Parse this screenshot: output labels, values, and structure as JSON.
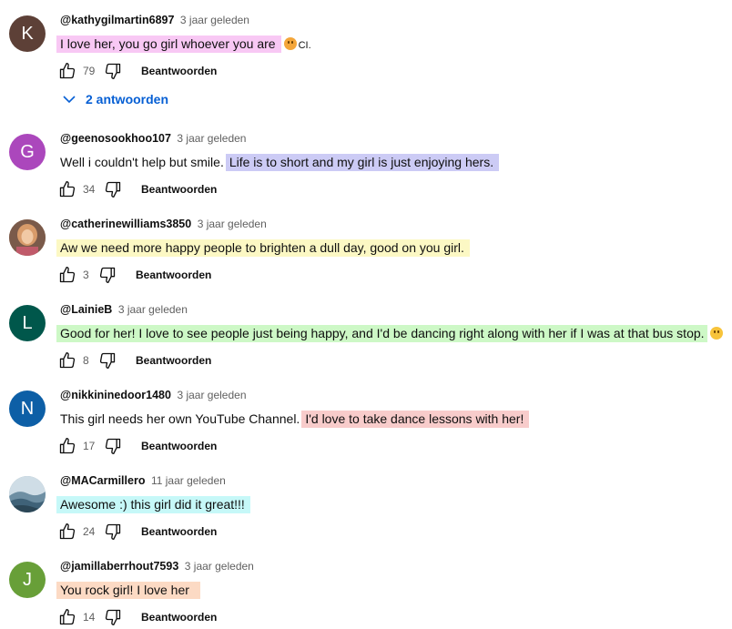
{
  "comments": [
    {
      "avatar_letter": "K",
      "avatar_color": "#5d4037",
      "author": "@kathygilmartin6897",
      "time": "3 jaar geleden",
      "text_plain": "",
      "text_highlight": "I love her, you go girl whoever you are",
      "highlight_color": "#f8c8f4",
      "emoji": "kiss-emoji",
      "text_suffix": "CI.",
      "likes": "79",
      "reply_label": "Beantwoorden",
      "replies_label": "2 antwoorden"
    },
    {
      "avatar_letter": "G",
      "avatar_color": "#ab47bc",
      "author": "@geenosookhoo107",
      "time": "3 jaar geleden",
      "text_plain": "Well i couldn't help but smile.",
      "text_highlight": "Life is to short and my girl is just enjoying hers.",
      "highlight_color": "#cccbf5",
      "likes": "34",
      "reply_label": "Beantwoorden"
    },
    {
      "avatar_letter": "",
      "avatar_color": "#b07a5a",
      "author": "@catherinewilliams3850",
      "time": "3 jaar geleden",
      "text_plain": "",
      "text_highlight": "Aw we need more happy people to brighten a dull day, good on you girl.",
      "highlight_color": "#fcf8c4",
      "likes": "3",
      "reply_label": "Beantwoorden"
    },
    {
      "avatar_letter": "L",
      "avatar_color": "#00574b",
      "author": "@LainieB",
      "time": "3 jaar geleden",
      "text_plain": "",
      "text_highlight": "Good for her! I love to see people just being happy, and I'd be dancing right along with her if I was at that bus stop.",
      "highlight_color": "#cdf8c6",
      "emoji": "smile-emoji",
      "likes": "8",
      "reply_label": "Beantwoorden"
    },
    {
      "avatar_letter": "N",
      "avatar_color": "#0d5fa6",
      "author": "@nikkininedoor1480",
      "time": "3 jaar geleden",
      "text_plain": "This girl needs her own YouTube Channel.",
      "text_highlight": "I'd love to take dance lessons with her!",
      "highlight_color": "#f8cccb",
      "likes": "17",
      "reply_label": "Beantwoorden"
    },
    {
      "avatar_letter": "",
      "avatar_color": "#8fa6b3",
      "author": "@MACarmillero",
      "time": "11 jaar geleden",
      "text_plain": "",
      "text_highlight": "Awesome :) this girl did it great!!!",
      "highlight_color": "#c6f8f8",
      "likes": "24",
      "reply_label": "Beantwoorden"
    },
    {
      "avatar_letter": "J",
      "avatar_color": "#689f38",
      "author": "@jamillaberrhout7593",
      "time": "3 jaar geleden",
      "text_plain": "",
      "text_highlight": "You rock girl! I love her",
      "highlight_color": "#fcdac4",
      "likes": "14",
      "reply_label": "Beantwoorden"
    }
  ]
}
